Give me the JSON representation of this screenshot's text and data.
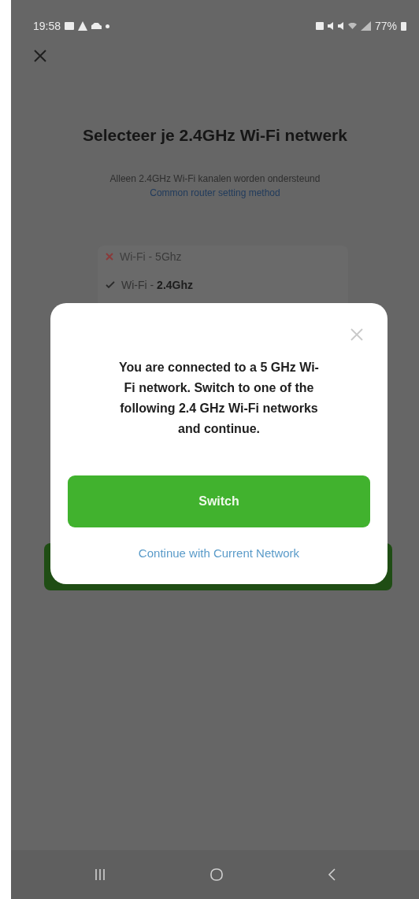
{
  "status_bar": {
    "time": "19:58",
    "battery": "77%"
  },
  "page": {
    "title": "Selecteer je 2.4GHz Wi-Fi netwerk",
    "subtitle": "Alleen 2.4GHz Wi-Fi kanalen worden ondersteund",
    "link": "Common router setting method"
  },
  "networks": [
    {
      "label": "Wi-Fi - ",
      "band": "5Ghz",
      "supported": false
    },
    {
      "label": "Wi-Fi - ",
      "band": "2.4Ghz",
      "supported": true
    }
  ],
  "dialog": {
    "message": "You are connected to a 5 GHz Wi-Fi network. Switch to one of the following 2.4 GHz Wi-Fi networks and continue.",
    "primary_button": "Switch",
    "secondary_link": "Continue with Current Network"
  }
}
